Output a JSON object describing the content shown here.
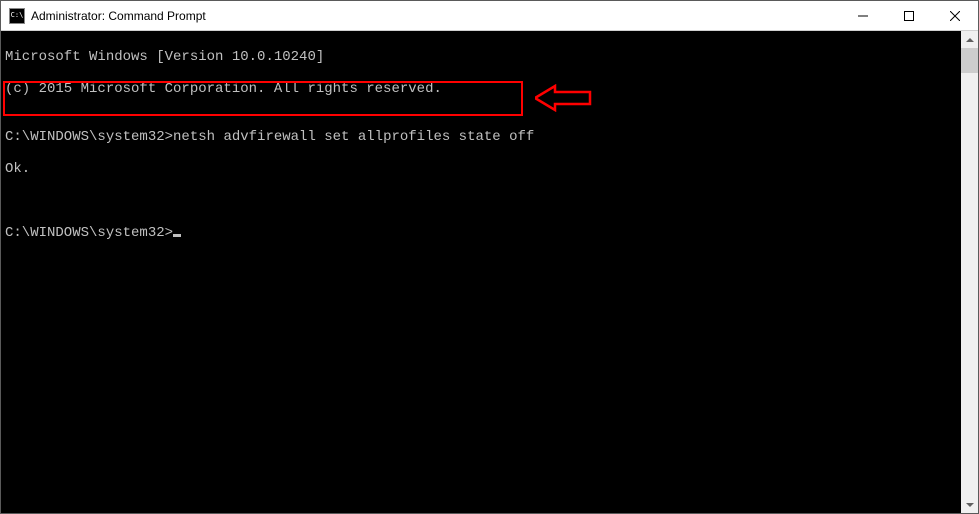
{
  "window": {
    "title": "Administrator: Command Prompt"
  },
  "console": {
    "line1": "Microsoft Windows [Version 10.0.10240]",
    "line2": "(c) 2015 Microsoft Corporation. All rights reserved.",
    "blank1": "",
    "prompt1_path": "C:\\WINDOWS\\system32>",
    "prompt1_command": "netsh advfirewall set allprofiles state off",
    "response1": "Ok.",
    "blank2": "",
    "blank3": "",
    "prompt2_path": "C:\\WINDOWS\\system32>"
  },
  "annotation": {
    "highlight_color": "#ff0000"
  }
}
